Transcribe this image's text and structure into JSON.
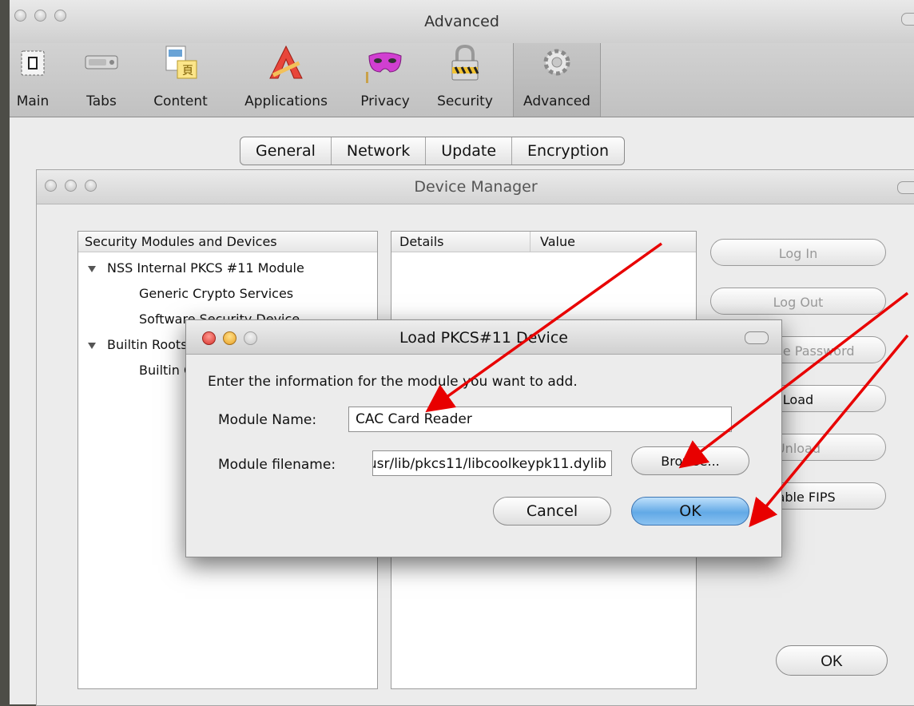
{
  "prefs_window": {
    "title": "Advanced",
    "toolbar": [
      {
        "id": "main",
        "label": "Main",
        "icon": "switch-icon"
      },
      {
        "id": "tabs",
        "label": "Tabs",
        "icon": "tabs-icon"
      },
      {
        "id": "content",
        "label": "Content",
        "icon": "content-icon"
      },
      {
        "id": "applications",
        "label": "Applications",
        "icon": "applications-icon"
      },
      {
        "id": "privacy",
        "label": "Privacy",
        "icon": "mask-icon"
      },
      {
        "id": "security",
        "label": "Security",
        "icon": "padlock-icon"
      },
      {
        "id": "advanced",
        "label": "Advanced",
        "icon": "gear-icon",
        "selected": true
      }
    ],
    "tabs": [
      "General",
      "Network",
      "Update",
      "Encryption"
    ]
  },
  "device_manager": {
    "title": "Device Manager",
    "tree_header": "Security Modules and Devices",
    "tree": [
      {
        "label": "NSS Internal PKCS #11 Module",
        "expanded": true,
        "level": 0
      },
      {
        "label": "Generic Crypto Services",
        "level": 1
      },
      {
        "label": "Software Security Device",
        "level": 1
      },
      {
        "label": "Builtin Roots Module",
        "expanded": true,
        "level": 0
      },
      {
        "label": "Builtin Object Token",
        "level": 1
      }
    ],
    "details_headers": {
      "details": "Details",
      "value": "Value"
    },
    "buttons": {
      "log_in": "Log In",
      "log_out": "Log Out",
      "change_password": "Change Password",
      "load": "Load",
      "unload": "Unload",
      "enable_fips": "Enable FIPS",
      "ok": "OK"
    }
  },
  "dialog": {
    "title": "Load PKCS#11 Device",
    "intro": "Enter the information for the module you want to add.",
    "module_name_label": "Module Name:",
    "module_name_value": "CAC Card Reader",
    "module_filename_label": "Module filename:",
    "module_filename_value": "/usr/lib/pkcs11/libcoolkeypk11.dylib",
    "browse_label": "Browse...",
    "cancel_label": "Cancel",
    "ok_label": "OK"
  },
  "colors": {
    "annotation_arrow": "#e80000",
    "default_button": "#62a9e6",
    "close_light": "#e0443e",
    "minimize_light": "#f2b23c"
  }
}
